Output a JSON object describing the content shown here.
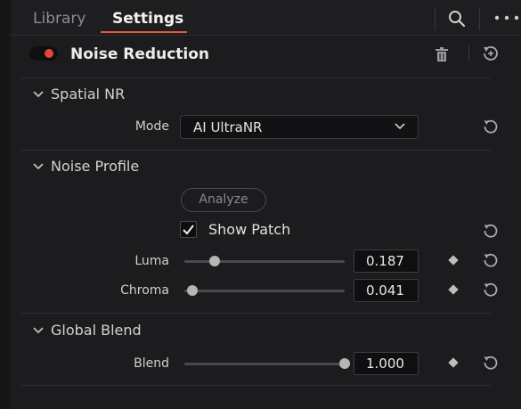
{
  "tabs": {
    "library": "Library",
    "settings": "Settings"
  },
  "header": {
    "title": "Noise Reduction",
    "toggle_on": true
  },
  "spatial_nr": {
    "title": "Spatial NR",
    "mode_label": "Mode",
    "mode_value": "AI UltraNR"
  },
  "noise_profile": {
    "title": "Noise Profile",
    "analyze_label": "Analyze",
    "show_patch_label": "Show Patch",
    "show_patch_checked": true,
    "luma_label": "Luma",
    "luma_value": "0.187",
    "luma_fraction": 0.19,
    "chroma_label": "Chroma",
    "chroma_value": "0.041",
    "chroma_fraction": 0.05
  },
  "global_blend": {
    "title": "Global Blend",
    "blend_label": "Blend",
    "blend_value": "1.000",
    "blend_fraction": 1.0
  },
  "colors": {
    "accent": "#e35a3b",
    "toggle": "#e2463b"
  }
}
